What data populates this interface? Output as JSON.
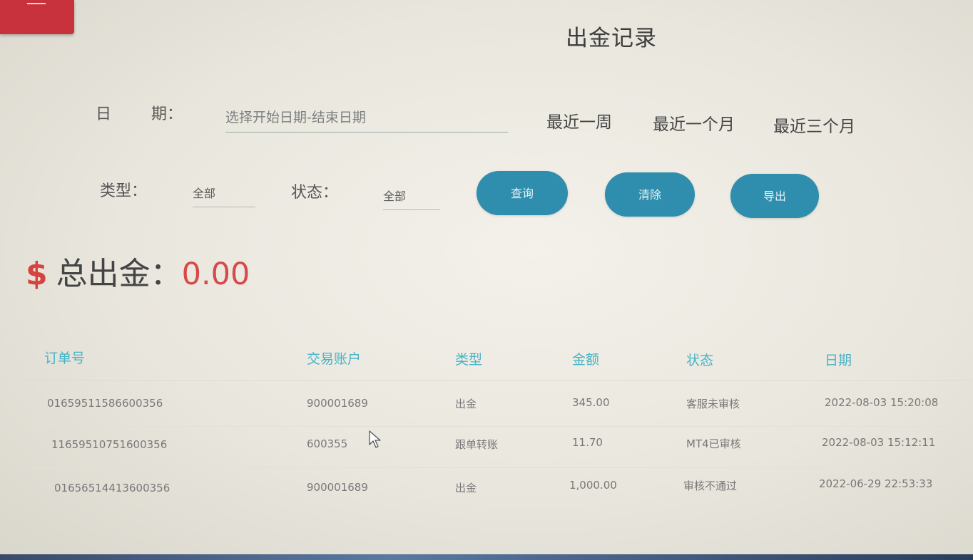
{
  "header": {
    "title": "出金记录"
  },
  "filters": {
    "date_label_a": "日",
    "date_label_b": "期：",
    "date_placeholder": "选择开始日期-结束日期",
    "quick_ranges": [
      "最近一周",
      "最近一个月",
      "最近三个月"
    ],
    "type_label": "类型：",
    "type_value": "全部",
    "status_label": "状态：",
    "status_value": "全部",
    "buttons": {
      "query": "查询",
      "clear": "清除",
      "export": "导出"
    }
  },
  "summary": {
    "currency_symbol": "$",
    "label": "总出金：",
    "amount": "0.00"
  },
  "table": {
    "columns": [
      "订单号",
      "交易账户",
      "类型",
      "金额",
      "状态",
      "日期"
    ],
    "rows": [
      [
        "01659511586600356",
        "900001689",
        "出金",
        "345.00",
        "客服未审核",
        "2022-08-03 15:20:08"
      ],
      [
        "11659510751600356",
        "600355",
        "跟单转账",
        "11.70",
        "MT4已审核",
        "2022-08-03 15:12:11"
      ],
      [
        "01656514413600356",
        "900001689",
        "出金",
        "1,000.00",
        "审核不通过",
        "2022-06-29 22:53:33"
      ]
    ]
  },
  "icons": {
    "corner": "menu-icon",
    "pointer": "mouse-cursor-icon"
  },
  "colors": {
    "accent_button": "#2f8eae",
    "table_header": "#48b3c6",
    "total_amount": "#d8494a",
    "corner_tab": "#c8323c"
  }
}
